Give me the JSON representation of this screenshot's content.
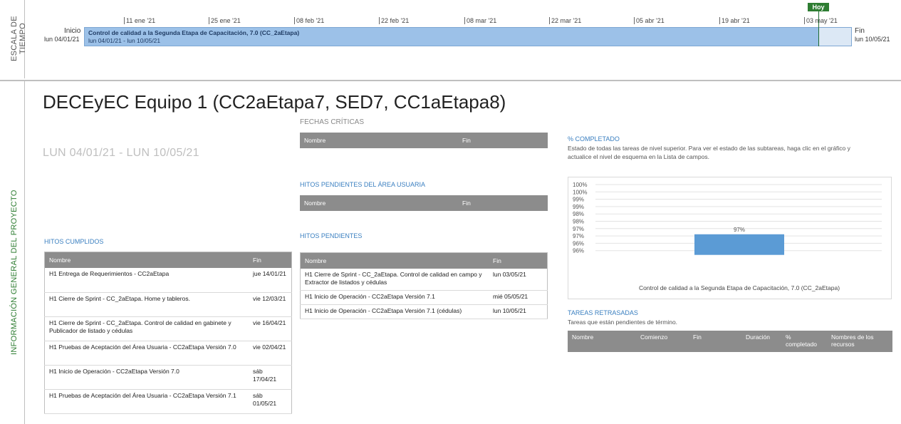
{
  "timeline": {
    "side_label": "ESCALA DE TIEMPO",
    "start_label": "Inicio",
    "start_date": "lun 04/01/21",
    "end_label": "Fin",
    "end_date": "lun 10/05/21",
    "today_label": "Hoy",
    "ticks": [
      "11 ene '21",
      "25 ene '21",
      "08 feb '21",
      "22 feb '21",
      "08 mar '21",
      "22 mar '21",
      "05 abr '21",
      "19 abr '21",
      "03 may '21"
    ],
    "bar_title": "Control de calidad a la Segunda Etapa de Capacitación, 7.0 (CC_2aEtapa)",
    "bar_dates": "lun 04/01/21 - lun 10/05/21"
  },
  "side_label": "INFORMACIÓN GENERAL DEL PROYECTO",
  "page_title": "DECEyEC Equipo 1 (CC2aEtapa7, SED7, CC1aEtapa8)",
  "date_range": "LUN 04/01/21 -  LUN 10/05/21",
  "fechas_criticas": {
    "title": "FECHAS CRÍTICAS",
    "columns": [
      "Nombre",
      "Fin"
    ]
  },
  "hitos_pendientes_area": {
    "title": "HITOS PENDIENTES DEL ÁREA USUARIA",
    "columns": [
      "Nombre",
      "Fin"
    ]
  },
  "hitos_cumplidos": {
    "title": "HITOS CUMPLIDOS",
    "columns": [
      "Nombre",
      "Fin"
    ],
    "rows": [
      [
        "H1 Entrega de Requerimientos - CC2aEtapa",
        "jue 14/01/21"
      ],
      [
        "H1 Cierre de Sprint - CC_2aEtapa. Home y tableros.",
        "vie 12/03/21"
      ],
      [
        "H1 Cierre de Sprint - CC_2aEtapa. Control de calidad en gabinete y Publicador de listado y cédulas",
        "vie 16/04/21"
      ],
      [
        "H1 Pruebas de Aceptación del Área Usuaria - CC2aEtapa Versión 7.0",
        "vie 02/04/21"
      ],
      [
        "H1 Inicio de Operación - CC2aEtapa Versión 7.0",
        "sáb 17/04/21"
      ],
      [
        "H1 Pruebas de Aceptación del Área Usuaria - CC2aEtapa Versión 7.1",
        "sáb 01/05/21"
      ]
    ]
  },
  "hitos_pendientes": {
    "title": "HITOS PENDIENTES",
    "columns": [
      "Nombre",
      "Fin"
    ],
    "rows": [
      [
        "H1 Cierre de Sprint - CC_2aEtapa. Control de calidad en campo y Extractor de listados y cédulas",
        "lun 03/05/21"
      ],
      [
        "H1 Inicio de Operación - CC2aEtapa Versión 7.1",
        "mié 05/05/21"
      ],
      [
        "H1 Inicio de Operación - CC2aEtapa Versión 7.1 (cédulas)",
        "lun 10/05/21"
      ]
    ]
  },
  "completado": {
    "title": "% COMPLETADO",
    "description": "Estado de todas las tareas de nivel superior. Para ver el estado de las subtareas, haga clic en el gráfico y actualice el nivel de esquema en la Lista de campos."
  },
  "chart_data": {
    "type": "bar",
    "categories": [
      "Control de calidad a la Segunda Etapa de Capacitación, 7.0 (CC_2aEtapa)"
    ],
    "values": [
      97
    ],
    "data_labels": [
      "97%"
    ],
    "y_ticks": [
      "100%",
      "100%",
      "99%",
      "99%",
      "98%",
      "98%",
      "97%",
      "97%",
      "96%",
      "96%"
    ],
    "bar_color": "#5b9bd5",
    "grid": true
  },
  "tareas_retrasadas": {
    "title": "TAREAS RETRASADAS",
    "description": "Tareas que están pendientes de término.",
    "columns": [
      "Nombre",
      "Comienzo",
      "Fin",
      "Duración",
      "% completado",
      "Nombres de los recursos"
    ]
  },
  "colors": {
    "accent_green": "#2e7d32",
    "accent_blue": "#3a7fc0",
    "header_grey": "#8c8c8c",
    "timeline_bar": "#9cc1e8"
  }
}
